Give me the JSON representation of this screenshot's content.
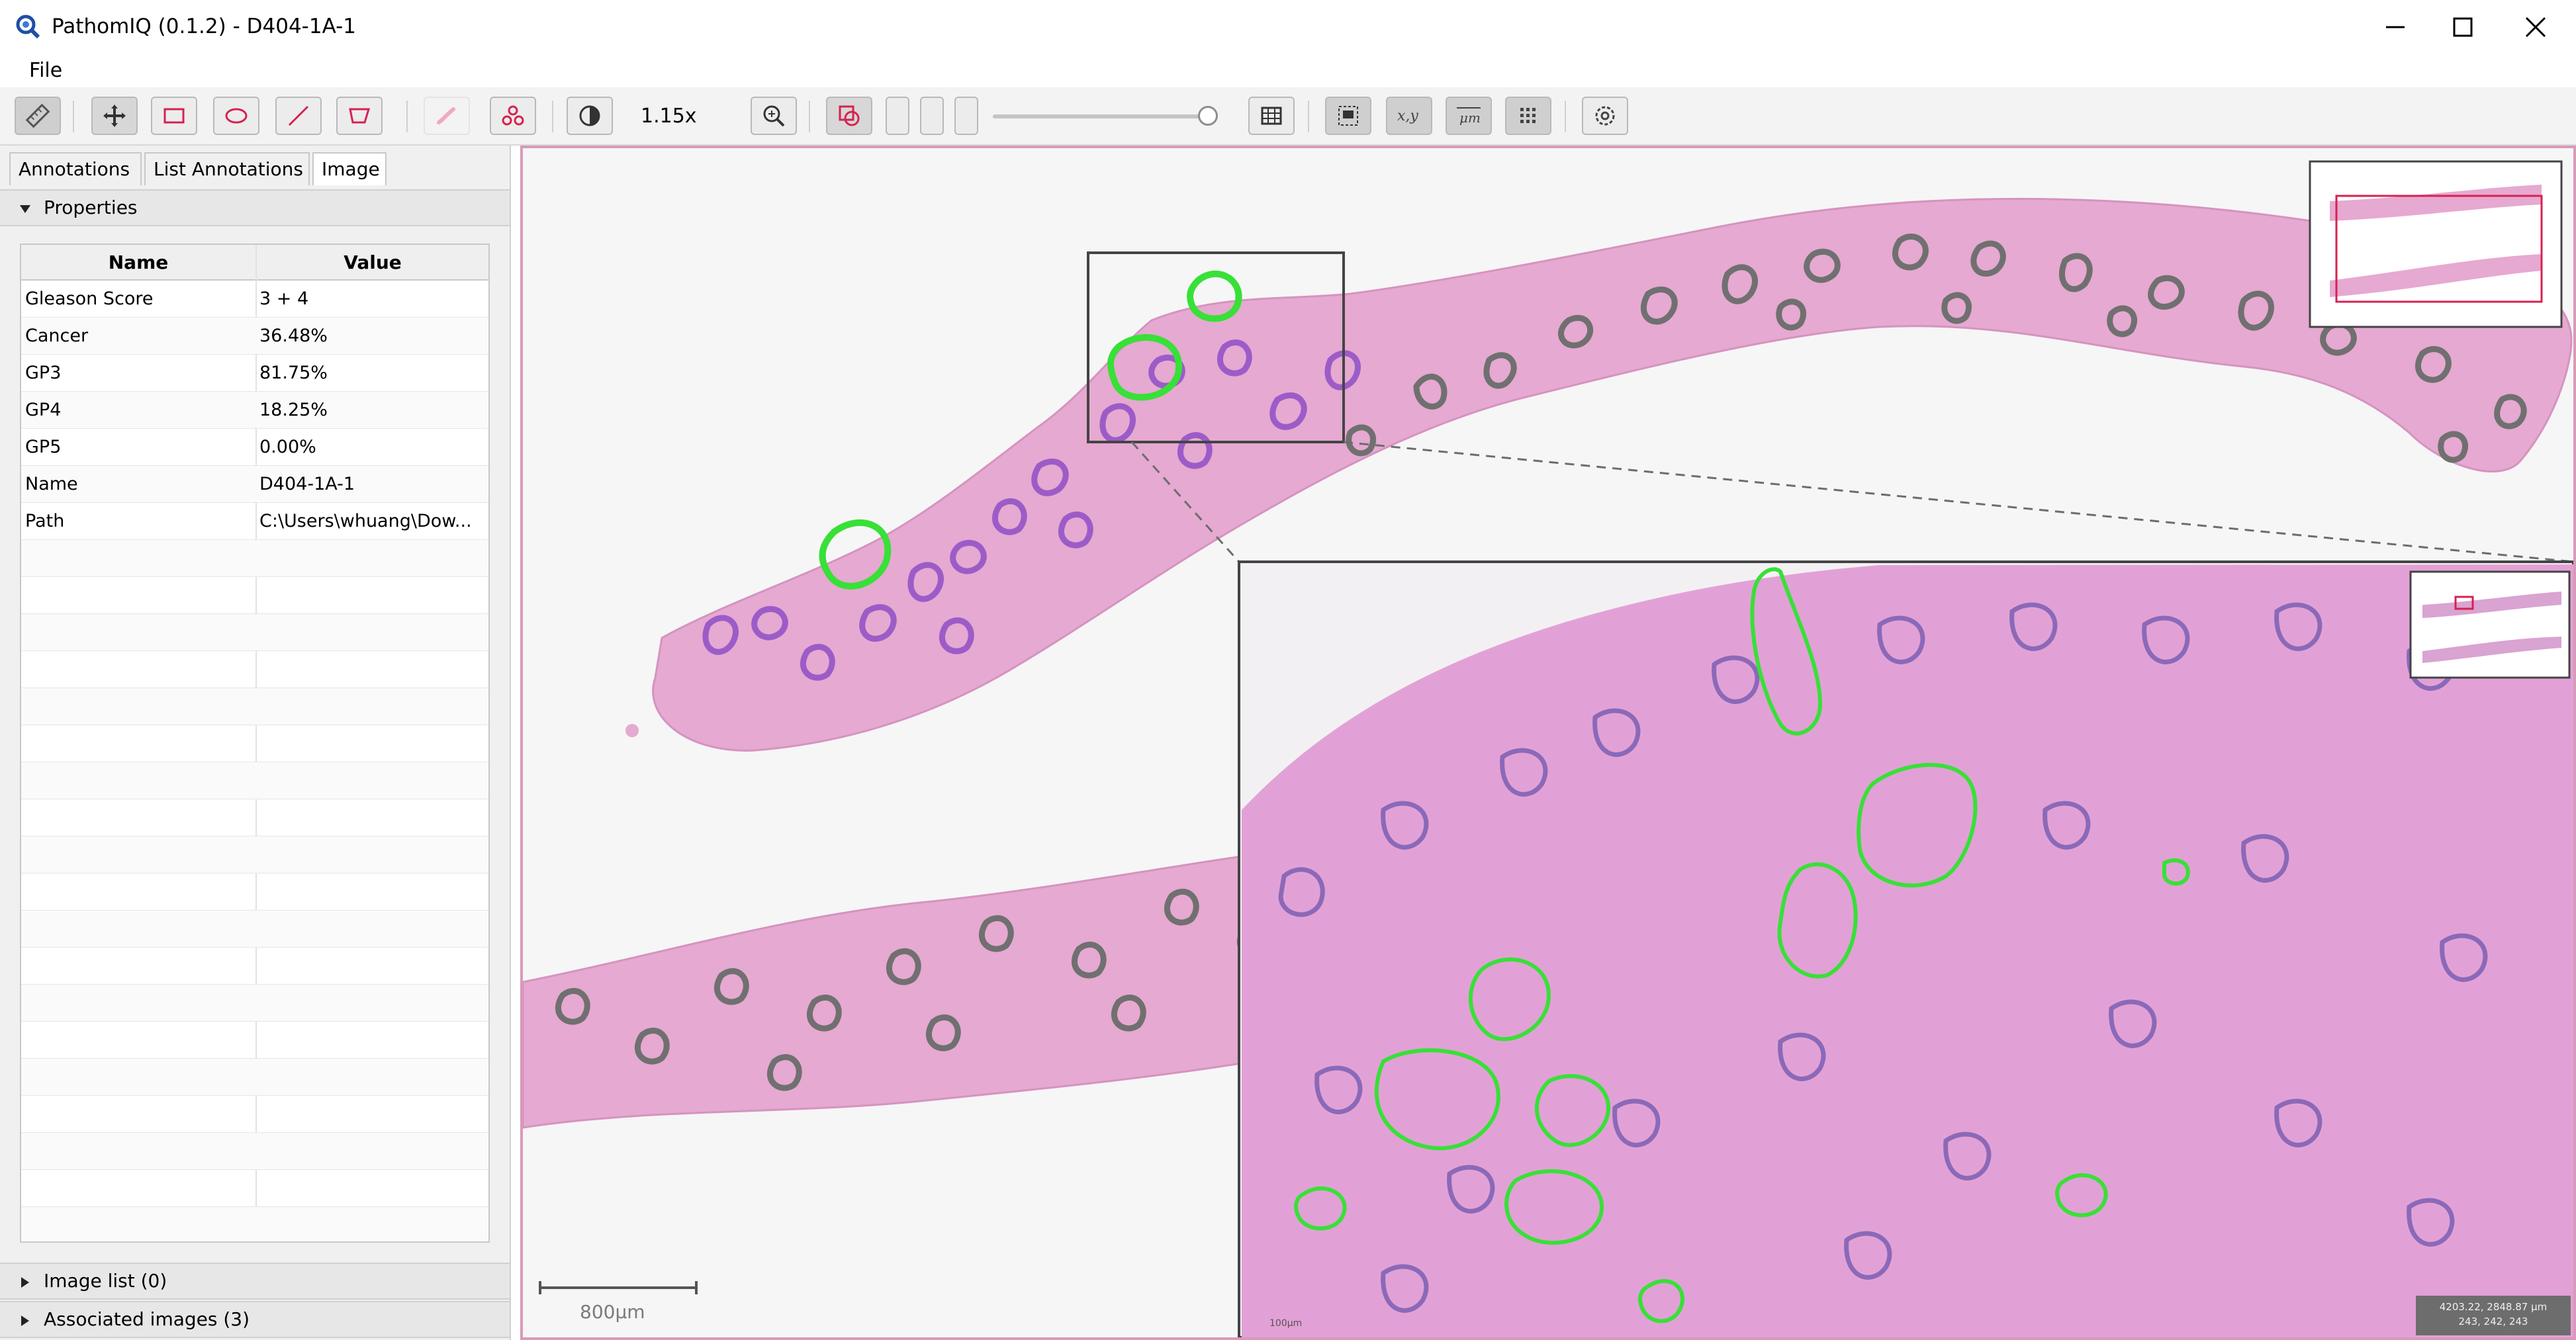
{
  "window": {
    "title": "PathomIQ (0.1.2) - D404-1A-1",
    "minimize_icon": "minimize-icon",
    "maximize_icon": "maximize-icon",
    "close_icon": "close-icon"
  },
  "menu": {
    "file": "File"
  },
  "toolbar": {
    "zoom_level": "1.15x",
    "icons": [
      "ruler-icon",
      "move-icon",
      "rectangle-icon",
      "ellipse-icon",
      "line-icon",
      "polygon-icon",
      "brush-icon",
      "cluster-icon",
      "contrast-icon",
      "zoom-icon",
      "overlay-icon",
      "grid-icon",
      "region-icon",
      "xy-icon",
      "micron-icon",
      "tiles-icon",
      "settings-icon"
    ],
    "xy_label": "x,y",
    "micron_label": "μm",
    "slider_value": 0.92
  },
  "tabs": [
    {
      "label": "Annotations"
    },
    {
      "label": "List Annotations"
    },
    {
      "label": "Image"
    }
  ],
  "properties": {
    "header": "Properties",
    "columns": {
      "name": "Name",
      "value": "Value"
    },
    "rows": [
      {
        "name": "Gleason Score",
        "value": "3 + 4"
      },
      {
        "name": "Cancer",
        "value": "36.48%"
      },
      {
        "name": "GP3",
        "value": "81.75%"
      },
      {
        "name": "GP4",
        "value": "18.25%"
      },
      {
        "name": "GP5",
        "value": "0.00%"
      },
      {
        "name": "Name",
        "value": "D404-1A-1"
      },
      {
        "name": "Path",
        "value": "C:\\Users\\whuang\\Dow..."
      }
    ]
  },
  "bottom_sections": {
    "image_list": "Image list (0)",
    "associated_images": "Associated images (3)"
  },
  "viewer": {
    "scale_label": "800μm",
    "coords": "4203.22, 2848.87 μm",
    "rgb": "243, 242, 243",
    "inset_scale_label": "100μm",
    "colors": {
      "tissue": "#e7a9d3",
      "gland_gp3": "#9c5cc8",
      "gland_benign": "#707070",
      "gp4_outline": "#38e038",
      "border": "#d99ab8"
    }
  }
}
